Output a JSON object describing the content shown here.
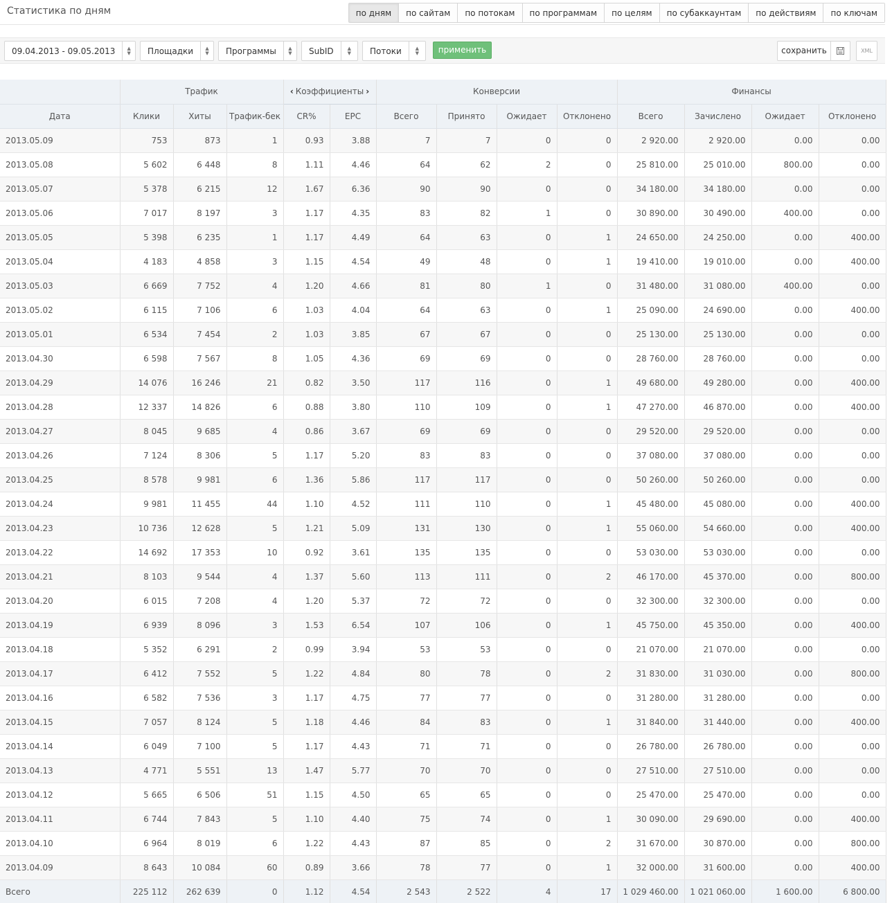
{
  "page_title": "Статистика по дням",
  "view_tabs": [
    {
      "label": "по дням",
      "active": true
    },
    {
      "label": "по сайтам",
      "active": false
    },
    {
      "label": "по потокам",
      "active": false
    },
    {
      "label": "по программам",
      "active": false
    },
    {
      "label": "по целям",
      "active": false
    },
    {
      "label": "по субаккаунтам",
      "active": false
    },
    {
      "label": "по действиям",
      "active": false
    },
    {
      "label": "по ключам",
      "active": false
    }
  ],
  "filters": {
    "date_range": "09.04.2013 - 09.05.2013",
    "sites": "Площадки",
    "programs": "Программы",
    "subid": "SubID",
    "streams": "Потоки",
    "apply_label": "применить",
    "save_label": "сохранить",
    "xml_label": "XML"
  },
  "table": {
    "groups": {
      "traffic": "Трафик",
      "coefficients": "Коэффициенты",
      "conversions": "Конверсии",
      "finances": "Финансы"
    },
    "columns": [
      "Дата",
      "Клики",
      "Хиты",
      "Трафик-бек",
      "CR%",
      "EPC",
      "Всего",
      "Принято",
      "Ожидает",
      "Отклонено",
      "Всего",
      "Зачислено",
      "Ожидает",
      "Отклонено"
    ],
    "rows": [
      [
        "2013.05.09",
        "753",
        "873",
        "1",
        "0.93",
        "3.88",
        "7",
        "7",
        "0",
        "0",
        "2 920.00",
        "2 920.00",
        "0.00",
        "0.00"
      ],
      [
        "2013.05.08",
        "5 602",
        "6 448",
        "8",
        "1.11",
        "4.46",
        "64",
        "62",
        "2",
        "0",
        "25 810.00",
        "25 010.00",
        "800.00",
        "0.00"
      ],
      [
        "2013.05.07",
        "5 378",
        "6 215",
        "12",
        "1.67",
        "6.36",
        "90",
        "90",
        "0",
        "0",
        "34 180.00",
        "34 180.00",
        "0.00",
        "0.00"
      ],
      [
        "2013.05.06",
        "7 017",
        "8 197",
        "3",
        "1.17",
        "4.35",
        "83",
        "82",
        "1",
        "0",
        "30 890.00",
        "30 490.00",
        "400.00",
        "0.00"
      ],
      [
        "2013.05.05",
        "5 398",
        "6 235",
        "1",
        "1.17",
        "4.49",
        "64",
        "63",
        "0",
        "1",
        "24 650.00",
        "24 250.00",
        "0.00",
        "400.00"
      ],
      [
        "2013.05.04",
        "4 183",
        "4 858",
        "3",
        "1.15",
        "4.54",
        "49",
        "48",
        "0",
        "1",
        "19 410.00",
        "19 010.00",
        "0.00",
        "400.00"
      ],
      [
        "2013.05.03",
        "6 669",
        "7 752",
        "4",
        "1.20",
        "4.66",
        "81",
        "80",
        "1",
        "0",
        "31 480.00",
        "31 080.00",
        "400.00",
        "0.00"
      ],
      [
        "2013.05.02",
        "6 115",
        "7 106",
        "6",
        "1.03",
        "4.04",
        "64",
        "63",
        "0",
        "1",
        "25 090.00",
        "24 690.00",
        "0.00",
        "400.00"
      ],
      [
        "2013.05.01",
        "6 534",
        "7 454",
        "2",
        "1.03",
        "3.85",
        "67",
        "67",
        "0",
        "0",
        "25 130.00",
        "25 130.00",
        "0.00",
        "0.00"
      ],
      [
        "2013.04.30",
        "6 598",
        "7 567",
        "8",
        "1.05",
        "4.36",
        "69",
        "69",
        "0",
        "0",
        "28 760.00",
        "28 760.00",
        "0.00",
        "0.00"
      ],
      [
        "2013.04.29",
        "14 076",
        "16 246",
        "21",
        "0.82",
        "3.50",
        "117",
        "116",
        "0",
        "1",
        "49 680.00",
        "49 280.00",
        "0.00",
        "400.00"
      ],
      [
        "2013.04.28",
        "12 337",
        "14 826",
        "6",
        "0.88",
        "3.80",
        "110",
        "109",
        "0",
        "1",
        "47 270.00",
        "46 870.00",
        "0.00",
        "400.00"
      ],
      [
        "2013.04.27",
        "8 045",
        "9 685",
        "4",
        "0.86",
        "3.67",
        "69",
        "69",
        "0",
        "0",
        "29 520.00",
        "29 520.00",
        "0.00",
        "0.00"
      ],
      [
        "2013.04.26",
        "7 124",
        "8 306",
        "5",
        "1.17",
        "5.20",
        "83",
        "83",
        "0",
        "0",
        "37 080.00",
        "37 080.00",
        "0.00",
        "0.00"
      ],
      [
        "2013.04.25",
        "8 578",
        "9 981",
        "6",
        "1.36",
        "5.86",
        "117",
        "117",
        "0",
        "0",
        "50 260.00",
        "50 260.00",
        "0.00",
        "0.00"
      ],
      [
        "2013.04.24",
        "9 981",
        "11 455",
        "44",
        "1.10",
        "4.52",
        "111",
        "110",
        "0",
        "1",
        "45 480.00",
        "45 080.00",
        "0.00",
        "400.00"
      ],
      [
        "2013.04.23",
        "10 736",
        "12 628",
        "5",
        "1.21",
        "5.09",
        "131",
        "130",
        "0",
        "1",
        "55 060.00",
        "54 660.00",
        "0.00",
        "400.00"
      ],
      [
        "2013.04.22",
        "14 692",
        "17 353",
        "10",
        "0.92",
        "3.61",
        "135",
        "135",
        "0",
        "0",
        "53 030.00",
        "53 030.00",
        "0.00",
        "0.00"
      ],
      [
        "2013.04.21",
        "8 103",
        "9 544",
        "4",
        "1.37",
        "5.60",
        "113",
        "111",
        "0",
        "2",
        "46 170.00",
        "45 370.00",
        "0.00",
        "800.00"
      ],
      [
        "2013.04.20",
        "6 015",
        "7 208",
        "4",
        "1.20",
        "5.37",
        "72",
        "72",
        "0",
        "0",
        "32 300.00",
        "32 300.00",
        "0.00",
        "0.00"
      ],
      [
        "2013.04.19",
        "6 939",
        "8 096",
        "3",
        "1.53",
        "6.54",
        "107",
        "106",
        "0",
        "1",
        "45 750.00",
        "45 350.00",
        "0.00",
        "400.00"
      ],
      [
        "2013.04.18",
        "5 352",
        "6 291",
        "2",
        "0.99",
        "3.94",
        "53",
        "53",
        "0",
        "0",
        "21 070.00",
        "21 070.00",
        "0.00",
        "0.00"
      ],
      [
        "2013.04.17",
        "6 412",
        "7 552",
        "5",
        "1.22",
        "4.84",
        "80",
        "78",
        "0",
        "2",
        "31 830.00",
        "31 030.00",
        "0.00",
        "800.00"
      ],
      [
        "2013.04.16",
        "6 582",
        "7 536",
        "3",
        "1.17",
        "4.75",
        "77",
        "77",
        "0",
        "0",
        "31 280.00",
        "31 280.00",
        "0.00",
        "0.00"
      ],
      [
        "2013.04.15",
        "7 057",
        "8 124",
        "5",
        "1.18",
        "4.46",
        "84",
        "83",
        "0",
        "1",
        "31 840.00",
        "31 440.00",
        "0.00",
        "400.00"
      ],
      [
        "2013.04.14",
        "6 049",
        "7 100",
        "5",
        "1.17",
        "4.43",
        "71",
        "71",
        "0",
        "0",
        "26 780.00",
        "26 780.00",
        "0.00",
        "0.00"
      ],
      [
        "2013.04.13",
        "4 771",
        "5 551",
        "13",
        "1.47",
        "5.77",
        "70",
        "70",
        "0",
        "0",
        "27 510.00",
        "27 510.00",
        "0.00",
        "0.00"
      ],
      [
        "2013.04.12",
        "5 665",
        "6 506",
        "51",
        "1.15",
        "4.50",
        "65",
        "65",
        "0",
        "0",
        "25 470.00",
        "25 470.00",
        "0.00",
        "0.00"
      ],
      [
        "2013.04.11",
        "6 744",
        "7 843",
        "5",
        "1.10",
        "4.40",
        "75",
        "74",
        "0",
        "1",
        "30 090.00",
        "29 690.00",
        "0.00",
        "400.00"
      ],
      [
        "2013.04.10",
        "6 964",
        "8 019",
        "6",
        "1.22",
        "4.43",
        "87",
        "85",
        "0",
        "2",
        "31 670.00",
        "30 870.00",
        "0.00",
        "800.00"
      ],
      [
        "2013.04.09",
        "8 643",
        "10 084",
        "60",
        "0.89",
        "3.66",
        "78",
        "77",
        "0",
        "1",
        "32 000.00",
        "31 600.00",
        "0.00",
        "400.00"
      ]
    ],
    "totals": [
      "Всего",
      "225 112",
      "262 639",
      "0",
      "1.12",
      "4.54",
      "2 543",
      "2 522",
      "4",
      "17",
      "1 029 460.00",
      "1 021 060.00",
      "1 600.00",
      "6 800.00"
    ]
  },
  "colors": {
    "header_bg": "#eef2f6",
    "apply_green": "#6fc07a",
    "row_alt": "#f7f7f7"
  },
  "icons": {
    "select_arrows": "up-down-chevron-icon",
    "save": "floppy-disk-icon",
    "coef_prev": "chevron-left-icon",
    "coef_next": "chevron-right-icon"
  }
}
